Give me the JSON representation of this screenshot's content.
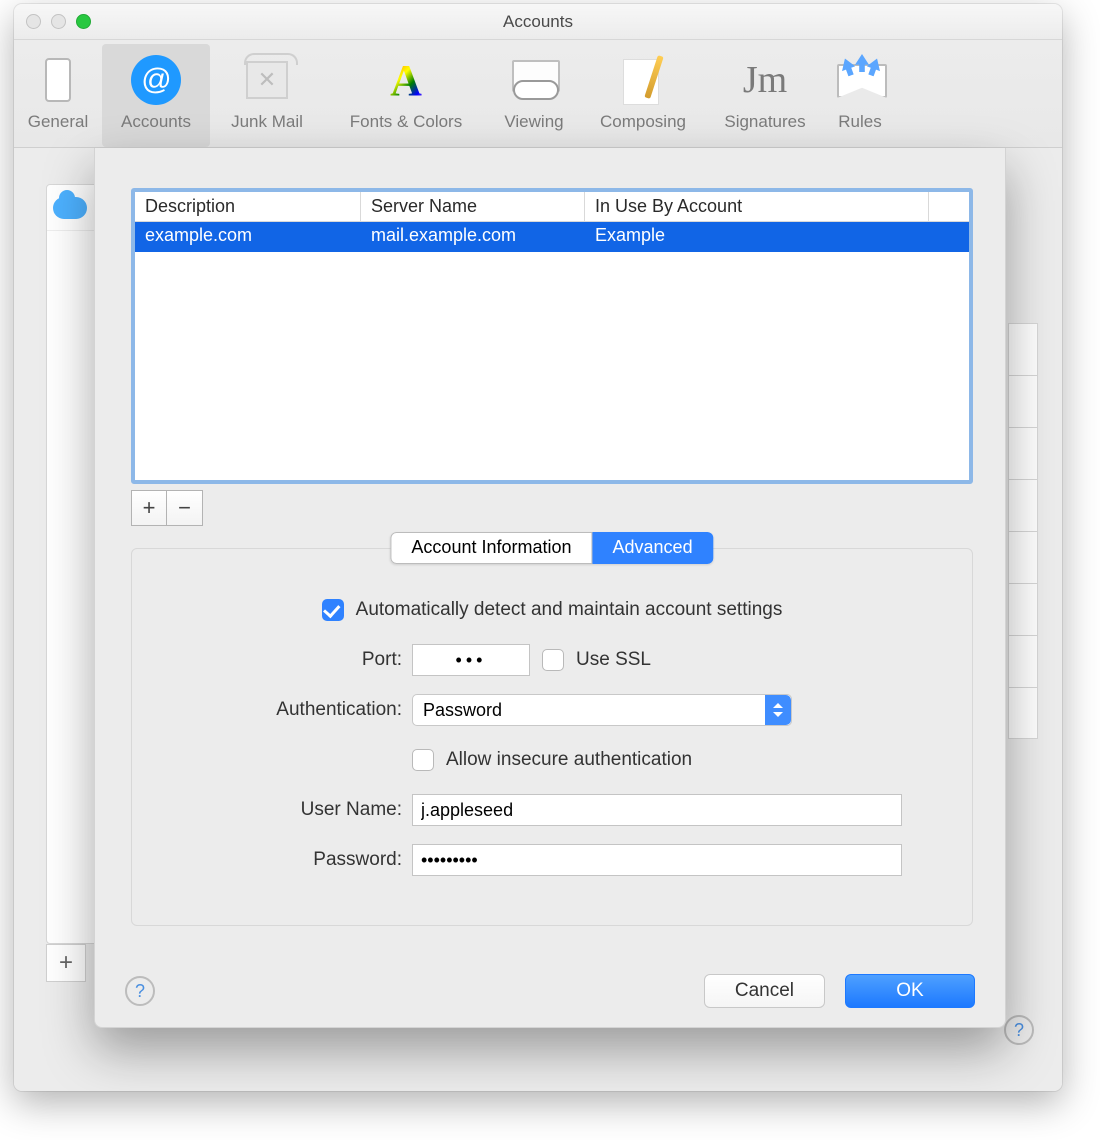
{
  "window": {
    "title": "Accounts"
  },
  "toolbar": {
    "items": [
      {
        "label": "General"
      },
      {
        "label": "Accounts"
      },
      {
        "label": "Junk Mail"
      },
      {
        "label": "Fonts & Colors"
      },
      {
        "label": "Viewing"
      },
      {
        "label": "Composing"
      },
      {
        "label": "Signatures"
      },
      {
        "label": "Rules"
      }
    ],
    "selected": "Accounts"
  },
  "sheet": {
    "list": {
      "columns": [
        "Description",
        "Server Name",
        "In Use By Account"
      ],
      "rows": [
        {
          "description": "example.com",
          "server": "mail.example.com",
          "usedby": "Example"
        }
      ]
    },
    "add_glyph": "+",
    "remove_glyph": "−",
    "segments": {
      "left": "Account Information",
      "right": "Advanced",
      "active": "Advanced"
    },
    "form": {
      "autodetect_checked": true,
      "autodetect_label": "Automatically detect and maintain account settings",
      "port_label": "Port:",
      "port_value": "•••",
      "use_ssl_checked": false,
      "use_ssl_label": "Use SSL",
      "auth_label": "Authentication:",
      "auth_value": "Password",
      "allow_insecure_checked": false,
      "allow_insecure_label": "Allow insecure authentication",
      "username_label": "User Name:",
      "username_value": "j.appleseed",
      "password_label": "Password:",
      "password_value": "•••••••••"
    },
    "buttons": {
      "cancel": "Cancel",
      "ok": "OK"
    }
  },
  "background": {
    "add_glyph": "+",
    "help_glyph": "?"
  }
}
